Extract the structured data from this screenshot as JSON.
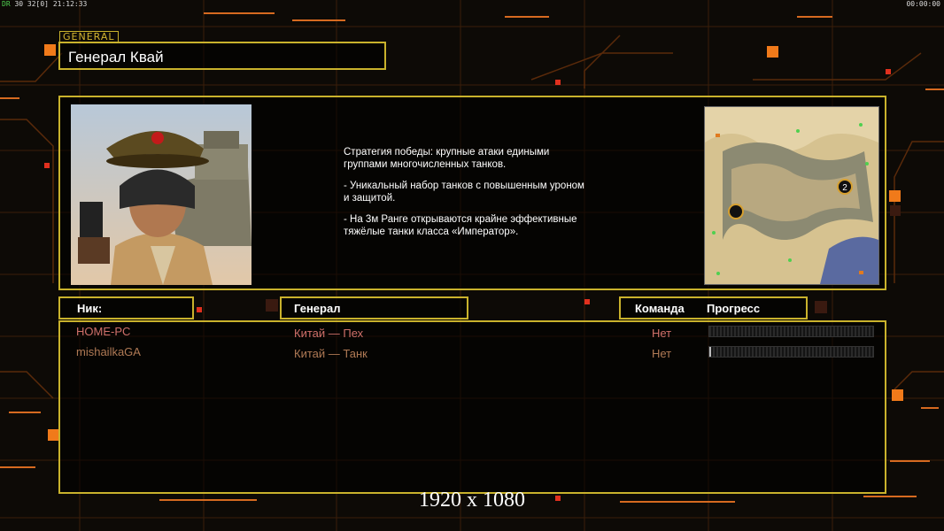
{
  "topbar": {
    "left_tag": "DR",
    "left_text": "30 32[0] 21:12:33",
    "right_text": "00:00:00"
  },
  "general_tag": "GENERAL",
  "general_name": "Генерал Квай",
  "description": {
    "lines": [
      "Стратегия победы: крупные атаки едиными\n группами многочисленных танков.",
      "- Уникальный набор танков с повышенным уроном\n и защитой.",
      "- На 3м Ранге открываются крайне эффективные\n тяжёлые танки класса «Император»."
    ]
  },
  "minimap": {
    "player_marker_2": "2"
  },
  "headers": {
    "nick": "Ник:",
    "general": "Генерал",
    "team": "Команда",
    "progress": "Прогресс"
  },
  "players": [
    {
      "nick": "HOME-PC",
      "general": "Китай — Пех",
      "team": "Нет",
      "progress": 0.0,
      "color": "#d0706a"
    },
    {
      "nick": "mishailkaGA",
      "general": "Китай — Танк",
      "team": "Нет",
      "progress": 0.01,
      "color": "#b07a55"
    }
  ],
  "resolution_label": "1920 x 1080",
  "colors": {
    "frame": "#c9b22c",
    "accent_orange": "#f07a1a",
    "accent_red": "#e0301e"
  }
}
